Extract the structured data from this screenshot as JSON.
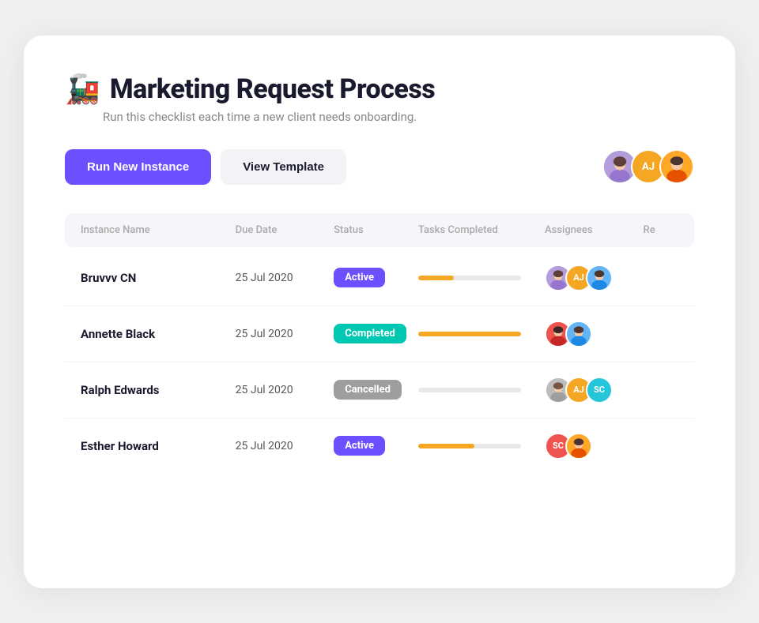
{
  "page": {
    "title": "Marketing Request Process",
    "emoji": "🚂",
    "subtitle": "Run this checklist each time a new client needs onboarding.",
    "toolbar": {
      "run_button": "Run New Instance",
      "view_button": "View Template"
    },
    "header_avatars": [
      {
        "type": "image",
        "color": "#9c7fe0",
        "initials": "",
        "label": "user-1"
      },
      {
        "type": "initials",
        "color": "#f5a623",
        "initials": "AJ",
        "label": "user-2"
      },
      {
        "type": "image",
        "color": "#f5a623",
        "initials": "",
        "label": "user-3"
      }
    ],
    "table": {
      "columns": [
        "Instance Name",
        "Due Date",
        "Status",
        "Tasks Completed",
        "Assignees",
        "Re"
      ],
      "rows": [
        {
          "name": "Bruvvv CN",
          "due_date": "25 Jul 2020",
          "status": "Active",
          "status_type": "active",
          "progress": 35,
          "assignees": [
            {
              "type": "image",
              "color": "#9c7fe0",
              "initials": "",
              "label": "av-purple"
            },
            {
              "type": "initials",
              "color": "#f5a623",
              "initials": "AJ",
              "label": "av-aj"
            },
            {
              "type": "image",
              "color": "#64b5f6",
              "initials": "",
              "label": "av-blue"
            }
          ]
        },
        {
          "name": "Annette Black",
          "due_date": "25 Jul 2020",
          "status": "Completed",
          "status_type": "completed",
          "progress": 100,
          "assignees": [
            {
              "type": "image",
              "color": "#ef5350",
              "initials": "",
              "label": "av-red"
            },
            {
              "type": "image",
              "color": "#64b5f6",
              "initials": "",
              "label": "av-blue2"
            }
          ]
        },
        {
          "name": "Ralph Edwards",
          "due_date": "25 Jul 2020",
          "status": "Cancelled",
          "status_type": "cancelled",
          "progress": 0,
          "assignees": [
            {
              "type": "image",
              "color": "#bdbdbd",
              "initials": "",
              "label": "av-gray"
            },
            {
              "type": "initials",
              "color": "#f5a623",
              "initials": "AJ",
              "label": "av-aj2"
            },
            {
              "type": "initials",
              "color": "#26c6da",
              "initials": "SC",
              "label": "av-sc"
            }
          ]
        },
        {
          "name": "Esther Howard",
          "due_date": "25 Jul 2020",
          "status": "Active",
          "status_type": "active",
          "progress": 55,
          "assignees": [
            {
              "type": "initials",
              "color": "#ef5350",
              "initials": "SC",
              "label": "av-sc2"
            },
            {
              "type": "image",
              "color": "#f5a623",
              "initials": "",
              "label": "av-orange"
            }
          ]
        }
      ]
    }
  }
}
